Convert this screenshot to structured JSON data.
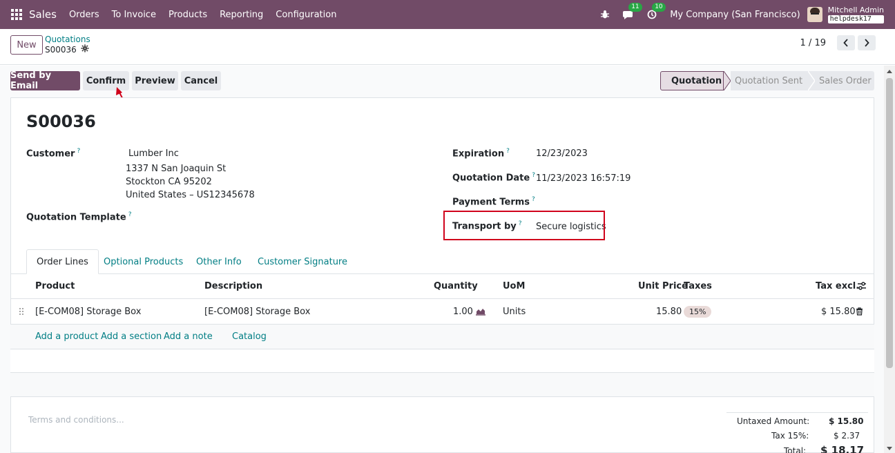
{
  "navbar": {
    "brand": "Sales",
    "menus": [
      "Orders",
      "To Invoice",
      "Products",
      "Reporting",
      "Configuration"
    ],
    "messages_count": "11",
    "activities_count": "10",
    "company": "My Company (San Francisco)",
    "user_name": "Mitchell Admin",
    "database": "helpdesk17"
  },
  "control_panel": {
    "new_label": "New",
    "breadcrumb_parent": "Quotations",
    "breadcrumb_current": "S00036",
    "pager_value": "1 / 19"
  },
  "actions": {
    "send_email": "Send by Email",
    "confirm": "Confirm",
    "preview": "Preview",
    "cancel": "Cancel"
  },
  "status_stages": [
    "Quotation",
    "Quotation Sent",
    "Sales Order"
  ],
  "form": {
    "title": "S00036",
    "customer_label": "Customer",
    "customer_name": "Lumber Inc",
    "customer_street": "1337 N San Joaquin St",
    "customer_city": "Stockton CA 95202",
    "customer_country": "United States – US12345678",
    "template_label": "Quotation Template",
    "expiration_label": "Expiration",
    "expiration_value": "12/23/2023",
    "quotation_date_label": "Quotation Date",
    "quotation_date_value": "11/23/2023 16:57:19",
    "payment_terms_label": "Payment Terms",
    "transport_label": "Transport by",
    "transport_value": "Secure logistics",
    "help_mark": "?"
  },
  "tabs": [
    "Order Lines",
    "Optional Products",
    "Other Info",
    "Customer Signature"
  ],
  "order_lines": {
    "columns": [
      "Product",
      "Description",
      "Quantity",
      "UoM",
      "Unit Price",
      "Taxes",
      "Tax excl."
    ],
    "rows": [
      {
        "product": "[E-COM08] Storage Box",
        "description": "[E-COM08] Storage Box",
        "quantity": "1.00",
        "uom": "Units",
        "unit_price": "15.80",
        "taxes": "15%",
        "subtotal": "$ 15.80"
      }
    ],
    "add_product": "Add a product",
    "add_section": "Add a section",
    "add_note": "Add a note",
    "catalog": "Catalog"
  },
  "footer": {
    "terms_placeholder": "Terms and conditions...",
    "untaxed_label": "Untaxed Amount:",
    "untaxed_value": "$ 15.80",
    "tax_label": "Tax 15%:",
    "tax_value": "$ 2.37",
    "total_label": "Total:",
    "total_value": "$ 18.17"
  },
  "colors": {
    "brand": "#714B67",
    "link": "#017e84",
    "annotation_red": "#d0021b"
  }
}
